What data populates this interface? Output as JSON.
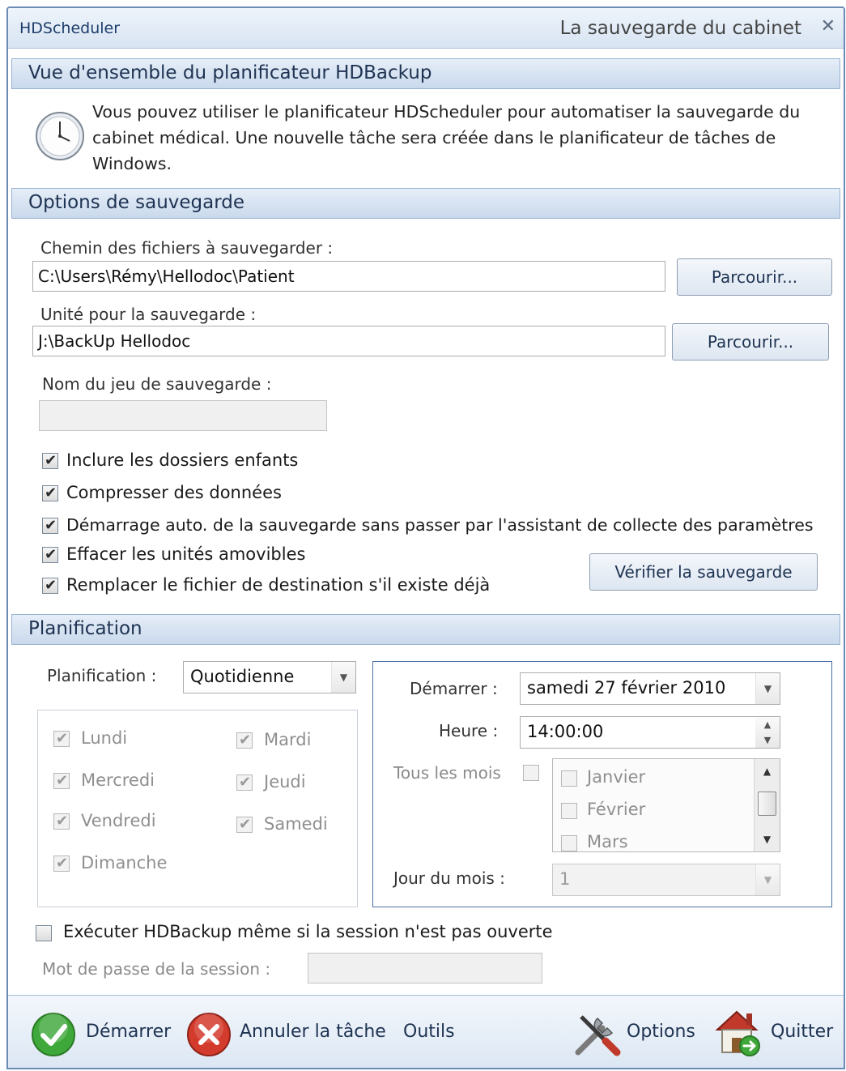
{
  "window": {
    "app_title": "HDScheduler",
    "subtitle": "La sauvegarde du cabinet",
    "close_glyph": "✕"
  },
  "overview": {
    "header": "Vue d'ensemble du planificateur HDBackup",
    "icon": "clock-icon",
    "text": "Vous pouvez utiliser le planificateur HDScheduler pour automatiser la sauvegarde du cabinet médical. Une nouvelle tâche sera créée dans le planificateur de tâches de Windows."
  },
  "options": {
    "header": "Options de sauvegarde",
    "source_label": "Chemin des fichiers à sauvegarder :",
    "source_value": "C:\\Users\\Rémy\\Hellodoc\\Patient",
    "browse_label": "Parcourir...",
    "dest_label": "Unité pour la sauvegarde :",
    "dest_value": "J:\\BackUp Hellodoc",
    "set_name_label": "Nom du jeu de sauvegarde :",
    "set_name_value": "",
    "checkboxes": [
      {
        "label": "Inclure les dossiers enfants",
        "checked": true
      },
      {
        "label": "Compresser des données",
        "checked": true
      },
      {
        "label": "Démarrage auto. de la sauvegarde sans passer par l'assistant de collecte des paramètres",
        "checked": true
      },
      {
        "label": "Effacer les unités amovibles",
        "checked": true
      },
      {
        "label": "Remplacer le fichier de destination s'il existe déjà",
        "checked": true
      }
    ],
    "verify_label": "Vérifier la sauvegarde"
  },
  "schedule": {
    "header": "Planification",
    "frequency_label": "Planification :",
    "frequency_value": "Quotidienne",
    "days": [
      {
        "label": "Lundi",
        "checked": true
      },
      {
        "label": "Mardi",
        "checked": true
      },
      {
        "label": "Mercredi",
        "checked": true
      },
      {
        "label": "Jeudi",
        "checked": true
      },
      {
        "label": "Vendredi",
        "checked": true
      },
      {
        "label": "Samedi",
        "checked": true
      },
      {
        "label": "Dimanche",
        "checked": true
      }
    ],
    "start_label": "Démarrer :",
    "start_value": "samedi 27 février 2010",
    "time_label": "Heure :",
    "time_value": "14:00:00",
    "every_month_label": "Tous les mois",
    "every_month_checked": false,
    "months": [
      {
        "label": "Janvier",
        "checked": false
      },
      {
        "label": "Février",
        "checked": false
      },
      {
        "label": "Mars",
        "checked": false
      }
    ],
    "day_of_month_label": "Jour du mois :",
    "day_of_month_value": "1",
    "run_without_session_label": "Exécuter HDBackup même si la session n'est pas ouverte",
    "run_without_session_checked": false,
    "session_password_label": "Mot de passe de la session :",
    "session_password_value": ""
  },
  "toolbar": {
    "start_label": "Démarrer",
    "start_icon": "check-icon",
    "cancel_label": "Annuler la tâche",
    "cancel_icon": "cancel-icon",
    "tools_label": "Outils",
    "options_label": "Options",
    "options_icon": "tools-icon",
    "quit_label": "Quitter",
    "quit_icon": "house-exit-icon"
  },
  "colors": {
    "header_gradient_top": "#e6eef8",
    "header_gradient_bottom": "#c9d9ec",
    "title_text": "#1e3352",
    "check_green": "#3fa83a",
    "cancel_red": "#d33b2c"
  }
}
